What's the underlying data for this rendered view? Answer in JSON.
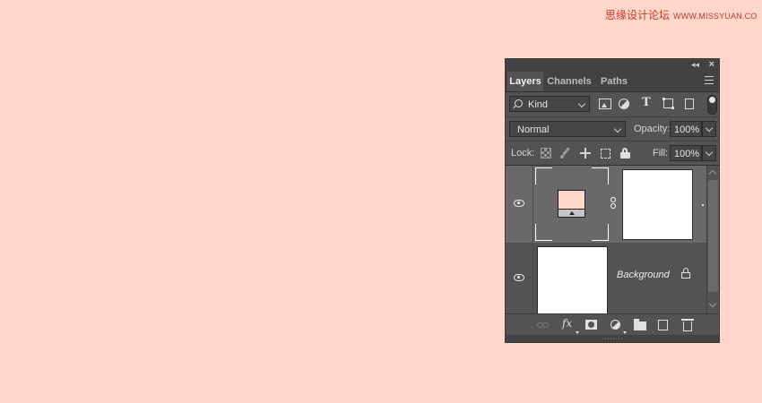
{
  "watermark": {
    "cn": "思缘设计论坛",
    "url": "WWW.MISSYUAN.COM"
  },
  "panel": {
    "tabs": [
      {
        "label": "Layers",
        "active": true
      },
      {
        "label": "Channels",
        "active": false
      },
      {
        "label": "Paths",
        "active": false
      }
    ],
    "filter": {
      "kind_label": "Kind",
      "icons": [
        "image-filter-icon",
        "adjustment-filter-icon",
        "type-filter-icon",
        "shape-filter-icon",
        "smart-object-filter-icon"
      ]
    },
    "blend": {
      "mode": "Normal",
      "opacity_label": "Opacity:",
      "opacity_value": "100%"
    },
    "lock": {
      "label": "Lock:",
      "fill_label": "Fill:",
      "fill_value": "100%"
    },
    "layers": [
      {
        "name": "",
        "type": "solid-color-fill",
        "fill_color": "#ffd6ca",
        "selected": true,
        "visible": true
      },
      {
        "name": "Background",
        "type": "background",
        "selected": false,
        "visible": true,
        "locked": true
      }
    ],
    "bottom_icons": [
      "link-layers-icon",
      "fx-icon",
      "add-mask-icon",
      "new-adjustment-icon",
      "new-group-icon",
      "new-layer-icon",
      "delete-layer-icon"
    ]
  },
  "colors": {
    "canvas": "#ffd6ca",
    "panel": "#535353",
    "selected_layer": "#696969"
  }
}
